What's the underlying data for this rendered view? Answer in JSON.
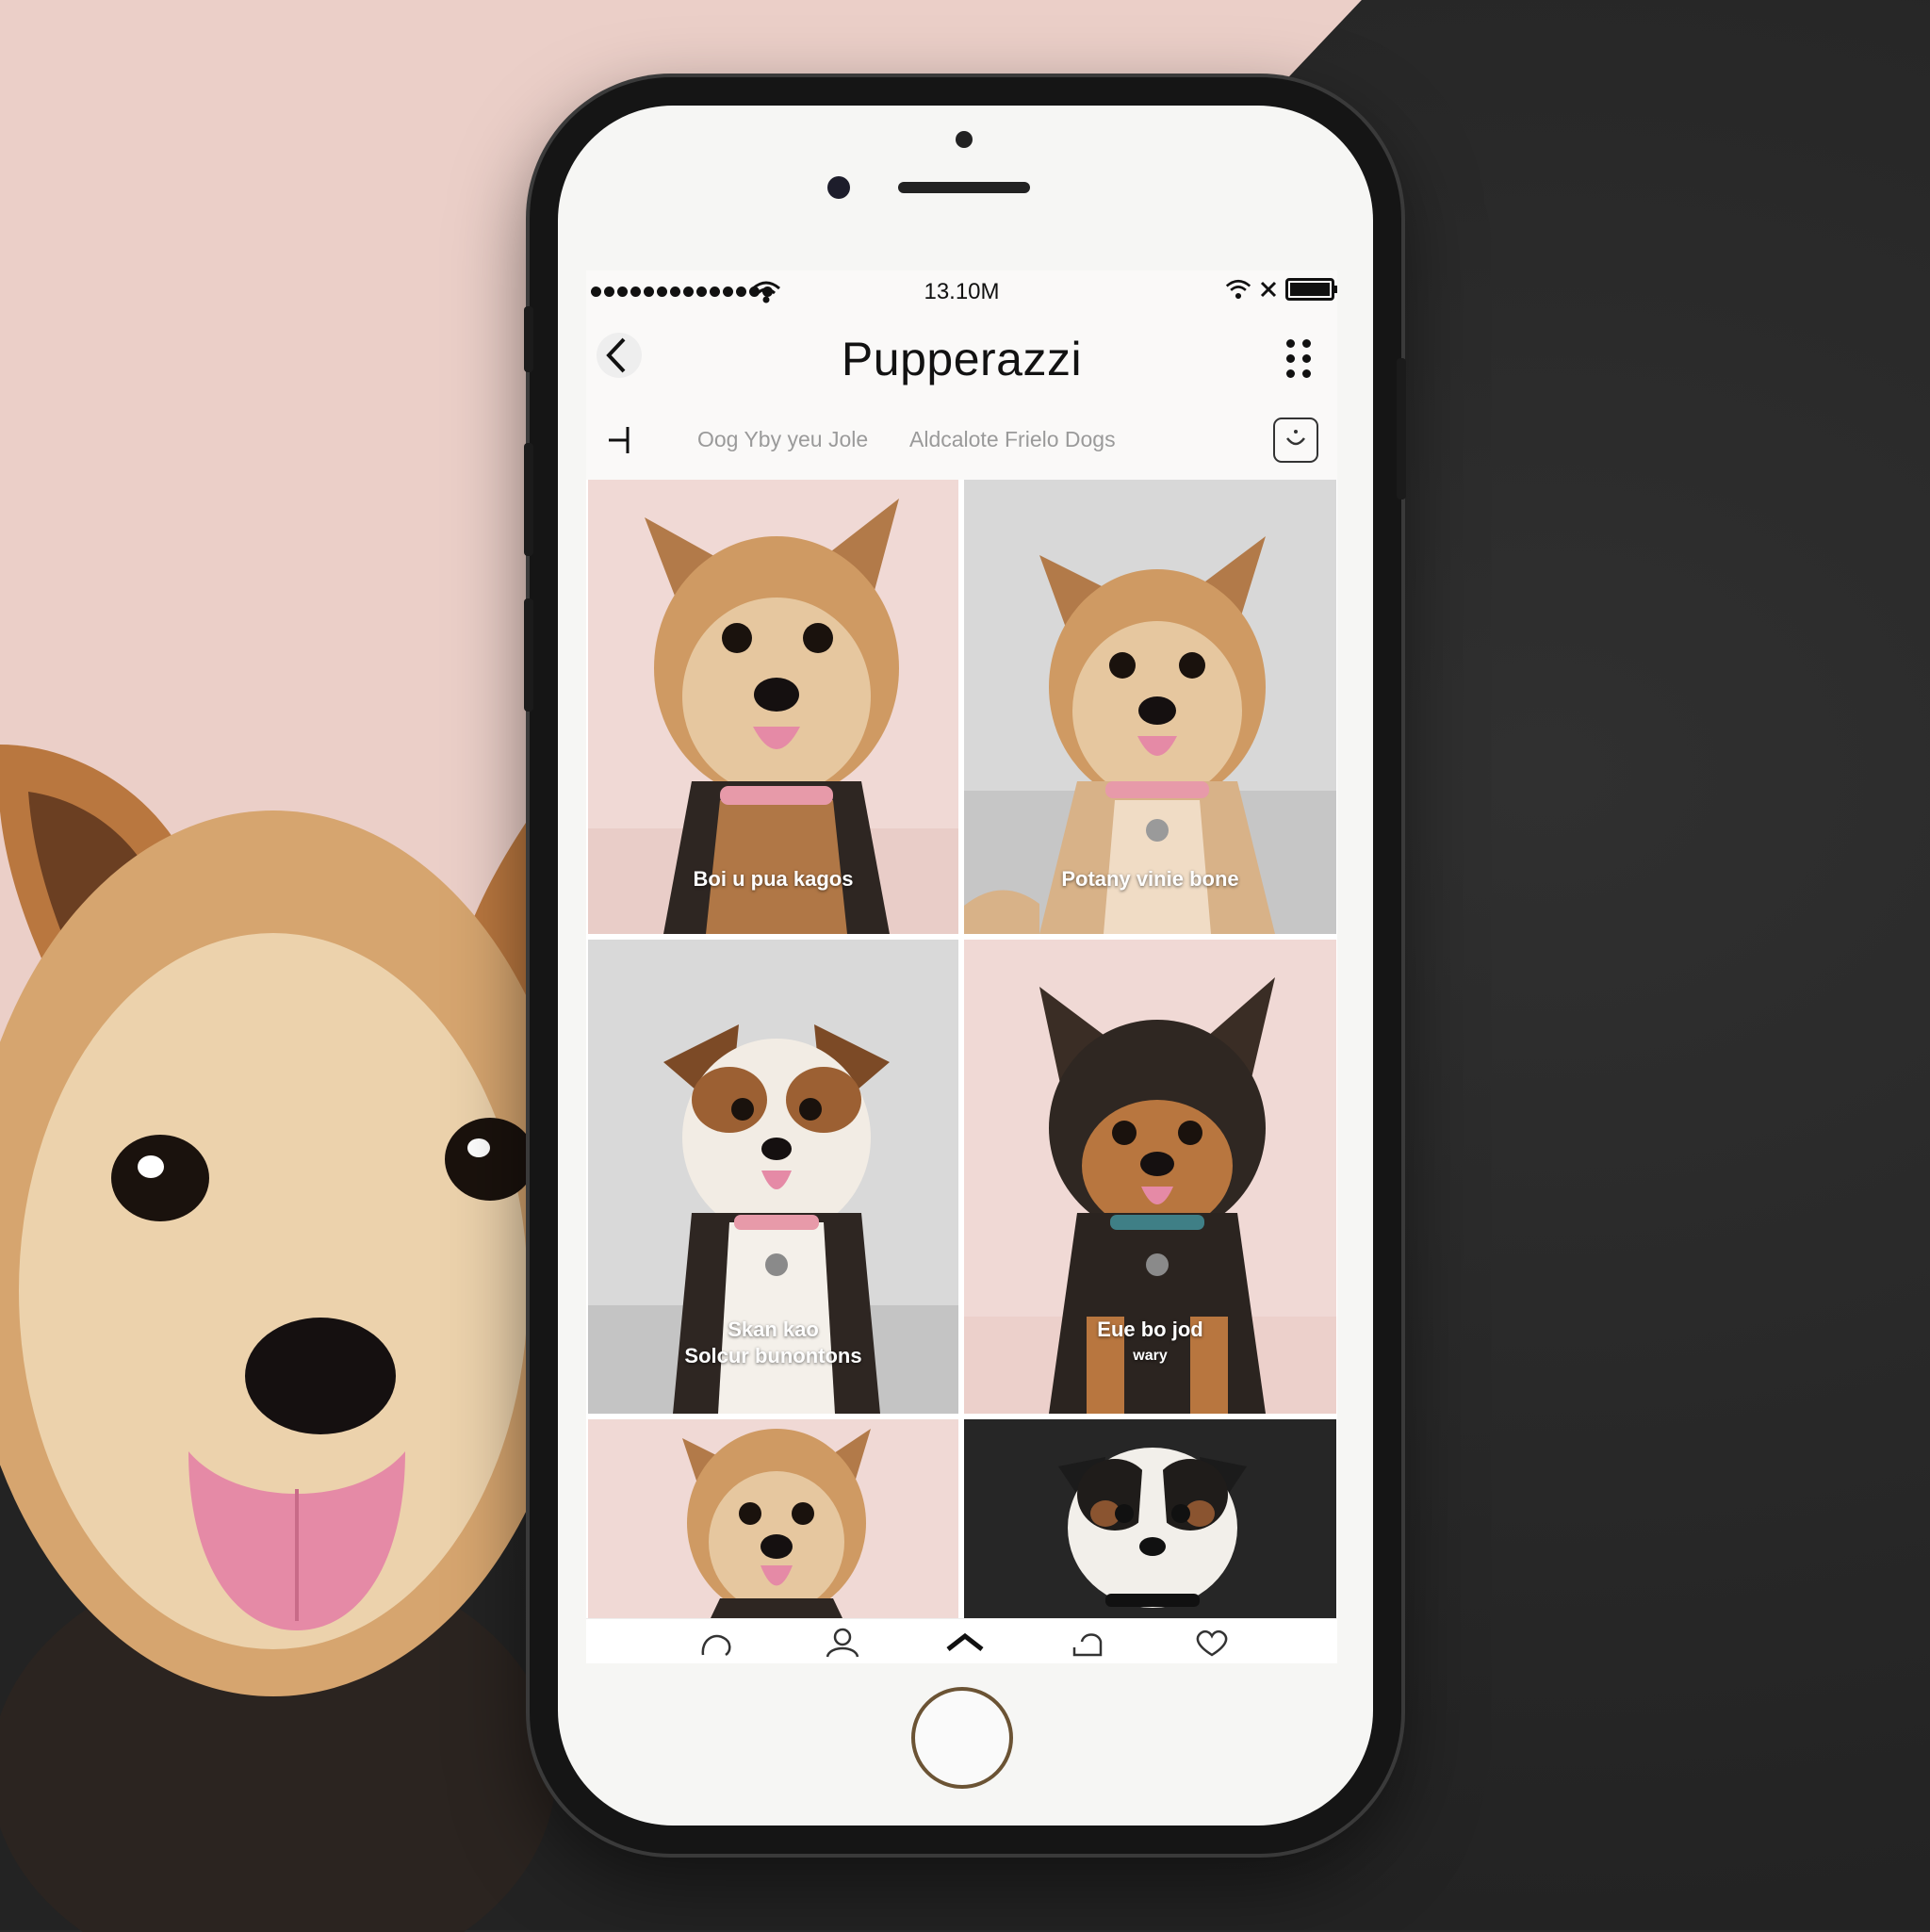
{
  "status_bar": {
    "time": "13.10M"
  },
  "header": {
    "title": "Pupperazzi"
  },
  "filters": {
    "tabs": [
      "Oog Yby yeu Jole",
      "Aldcalote Frielo Dogs"
    ]
  },
  "grid": {
    "captions": [
      [
        "Boi u pua kagos"
      ],
      [
        "Potany vinie bone"
      ],
      [
        "Skan kao",
        "Solcur bunontons"
      ],
      [
        "Eue bo jod",
        "wary"
      ],
      [
        ""
      ],
      [
        ""
      ]
    ]
  },
  "tab_bar": {
    "icons": [
      "chat-icon",
      "profile-icon",
      "home-caret-icon",
      "message-icon",
      "heart-icon"
    ]
  },
  "colors": {
    "pink_bg": "#ebcfc8",
    "dark_bg": "#252525",
    "tile_pink": "#f0d9d5",
    "tile_gray": "#d7d7d7",
    "tile_dark": "#262626",
    "fur_tan": "#c98b55",
    "fur_light": "#e9c9a1",
    "fur_black": "#2b2420",
    "collar_pink": "#e79aa9",
    "collar_teal": "#3f7f86",
    "tongue": "#e58aa6"
  }
}
